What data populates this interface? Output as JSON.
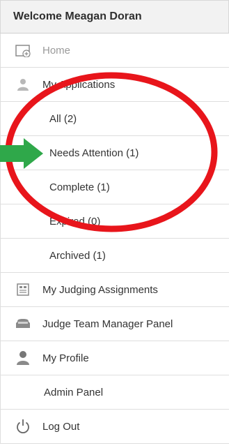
{
  "header": {
    "welcome": "Welcome Meagan Doran"
  },
  "menu": {
    "home": "Home",
    "my_applications": "My Applications",
    "all": "All (2)",
    "needs_attention": "Needs Attention (1)",
    "complete": "Complete (1)",
    "expired": "Expired (0)",
    "archived": "Archived (1)",
    "judging": "My Judging Assignments",
    "judge_team": "Judge Team Manager Panel",
    "profile": "My Profile",
    "admin": "Admin Panel",
    "logout": "Log Out"
  },
  "icons": {
    "home": "home-icon",
    "applications": "user-icon",
    "judging": "clipboard-icon",
    "judge_team": "folder-icon",
    "profile": "person-icon",
    "logout": "power-icon"
  },
  "annotation_colors": {
    "circle": "#e8151b",
    "arrow": "#2fa84a"
  }
}
